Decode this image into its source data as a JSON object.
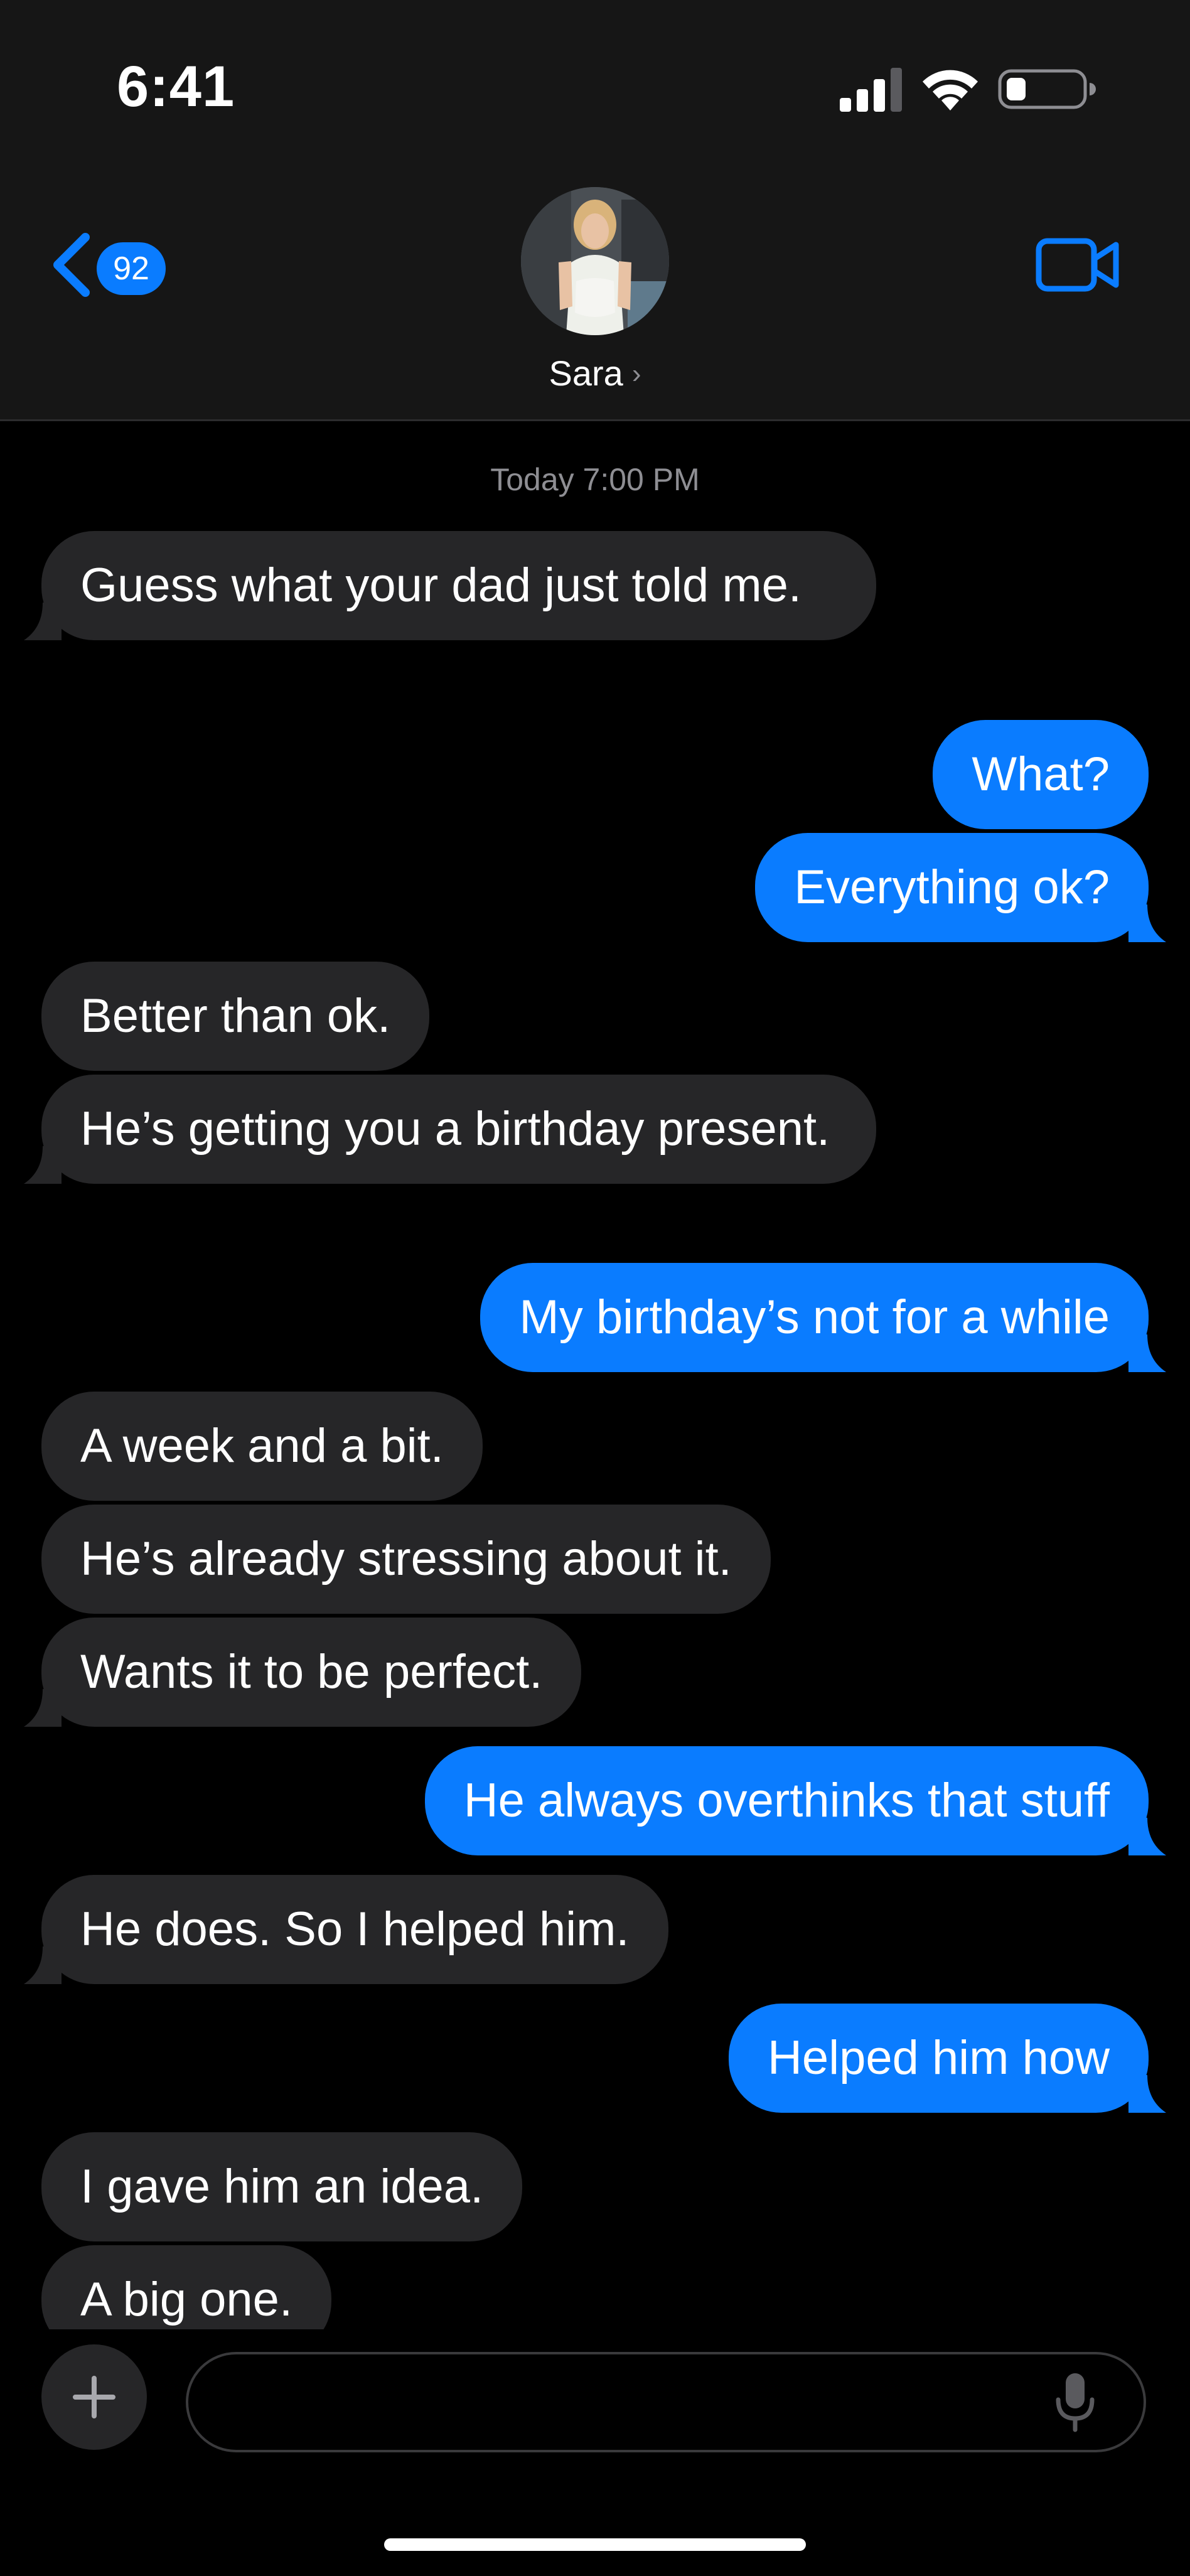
{
  "status_bar": {
    "time": "6:41"
  },
  "header": {
    "back_badge_count": "92",
    "contact_name": "Sara",
    "contact_chevron": "›"
  },
  "thread": {
    "timestamp": "Today 7:00 PM",
    "messages": [
      {
        "direction": "in",
        "text": "Guess what your dad just told me."
      },
      {
        "direction": "out",
        "text": "What?"
      },
      {
        "direction": "out",
        "text": "Everything ok?"
      },
      {
        "direction": "in",
        "text": "Better than ok."
      },
      {
        "direction": "in",
        "text": "He’s getting you a birthday present."
      },
      {
        "direction": "out",
        "text": "My birthday’s not for a while"
      },
      {
        "direction": "in",
        "text": "A week and a bit."
      },
      {
        "direction": "in",
        "text": "He’s already stressing about it."
      },
      {
        "direction": "in",
        "text": "Wants it to be perfect."
      },
      {
        "direction": "out",
        "text": "He always overthinks that stuff"
      },
      {
        "direction": "in",
        "text": "He does. So I helped him."
      },
      {
        "direction": "out",
        "text": "Helped him how"
      },
      {
        "direction": "in",
        "text": "I gave him an idea."
      },
      {
        "direction": "in",
        "text": "A big one."
      }
    ]
  },
  "input": {
    "value": "",
    "placeholder": ""
  },
  "colors": {
    "outgoing_bubble": "#0a7cff",
    "incoming_bubble": "#262628",
    "background": "#000000",
    "header": "#161616"
  },
  "icons": [
    "signal-icon",
    "wifi-icon",
    "battery-icon",
    "back-chevron-icon",
    "video-camera-icon",
    "plus-icon",
    "microphone-icon"
  ]
}
